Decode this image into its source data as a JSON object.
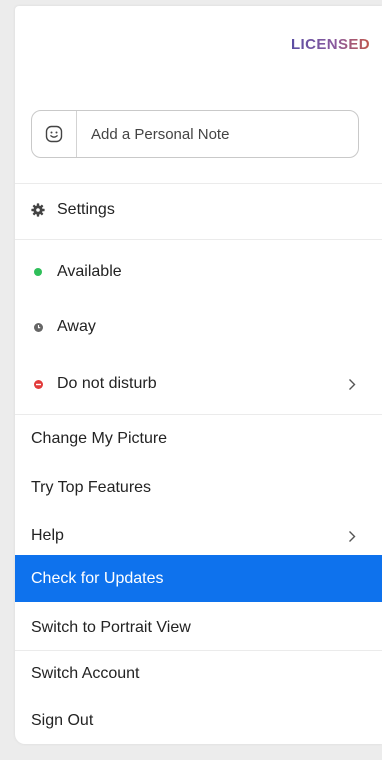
{
  "header": {
    "license_badge": "LICENSED"
  },
  "note": {
    "placeholder": "Add a Personal Note",
    "icon": "smiley-icon"
  },
  "menu": {
    "settings": {
      "label": "Settings",
      "icon": "gear-icon"
    },
    "status": [
      {
        "label": "Available",
        "color": "#2fbf5a",
        "icon": "green-dot-icon"
      },
      {
        "label": "Away",
        "color": "#666666",
        "icon": "clock-dot-icon"
      },
      {
        "label": "Do not disturb",
        "color": "#e23b3b",
        "icon": "minus-dot-icon",
        "has_submenu": true
      }
    ],
    "items": [
      {
        "label": "Change My Picture"
      },
      {
        "label": "Try Top Features"
      },
      {
        "label": "Help",
        "has_submenu": true
      },
      {
        "label": "Check for Updates",
        "highlighted": true
      },
      {
        "label": "Switch to Portrait View"
      },
      {
        "label": "Switch Account"
      },
      {
        "label": "Sign Out"
      }
    ]
  },
  "colors": {
    "highlight": "#0e72ed",
    "text": "#232323"
  }
}
